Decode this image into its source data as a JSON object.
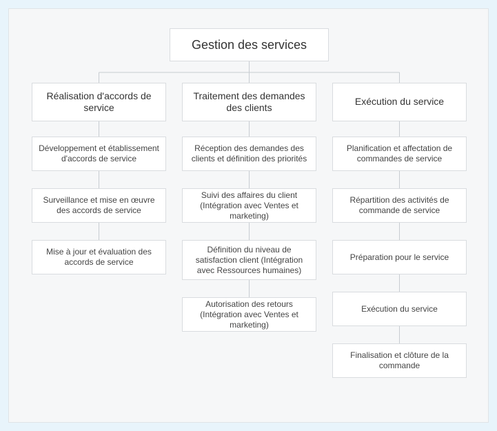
{
  "root": {
    "title": "Gestion des services"
  },
  "branches": [
    {
      "title": "Réalisation d'accords de service",
      "leaves": [
        "Développement et établissement d'accords de service",
        "Surveillance et mise en œuvre des accords de service",
        "Mise à jour et évaluation des accords de service"
      ]
    },
    {
      "title": "Traitement des demandes des clients",
      "leaves": [
        "Réception des demandes des clients et définition des priorités",
        "Suivi des affaires du client (Intégration avec Ventes et marketing)",
        "Définition du niveau de satisfaction client (Intégration avec Ressources humaines)",
        "Autorisation des retours (Intégration avec Ventes et marketing)"
      ]
    },
    {
      "title": "Exécution du service",
      "leaves": [
        "Planification et affectation de commandes de service",
        "Répartition des activités de commande de service",
        "Préparation pour le service",
        "Exécution du service",
        "Finalisation et clôture de la commande"
      ]
    }
  ]
}
